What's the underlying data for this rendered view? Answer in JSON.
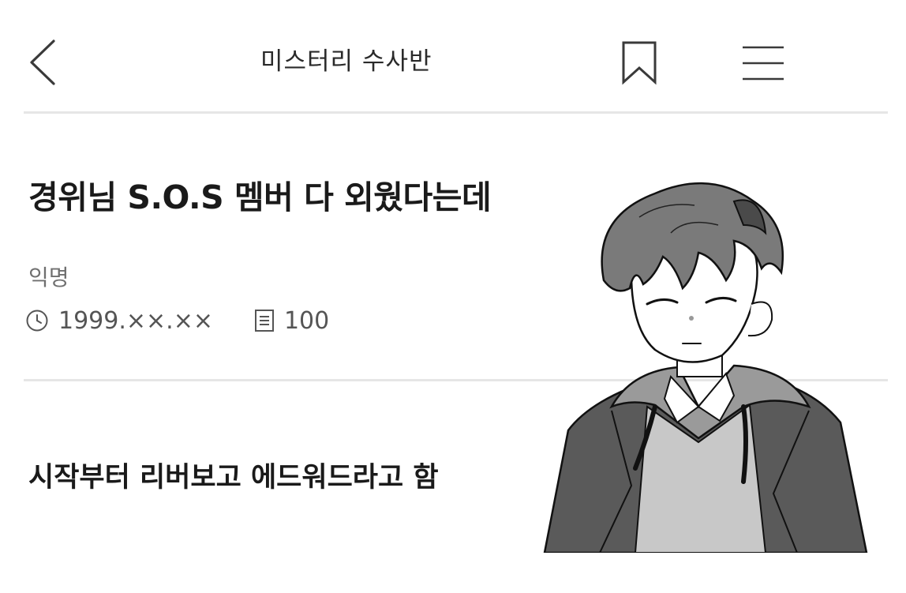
{
  "header": {
    "title": "미스터리 수사반",
    "back_icon": "chevron-left-icon",
    "bookmark_icon": "bookmark-icon",
    "menu_icon": "hamburger-menu-icon"
  },
  "post": {
    "title": "경위님 S.O.S 멤버 다 외웠다는데",
    "author": "익명",
    "date": "1999.××.××",
    "views": "100",
    "body": "시작부터 리버보고 에드워드라고 함"
  },
  "icons": {
    "date": "clock-icon",
    "views": "document-list-icon"
  },
  "colors": {
    "text": "#1e1e1e",
    "muted": "#6f6f6f",
    "divider": "#e6e6e6",
    "background": "#ffffff"
  }
}
